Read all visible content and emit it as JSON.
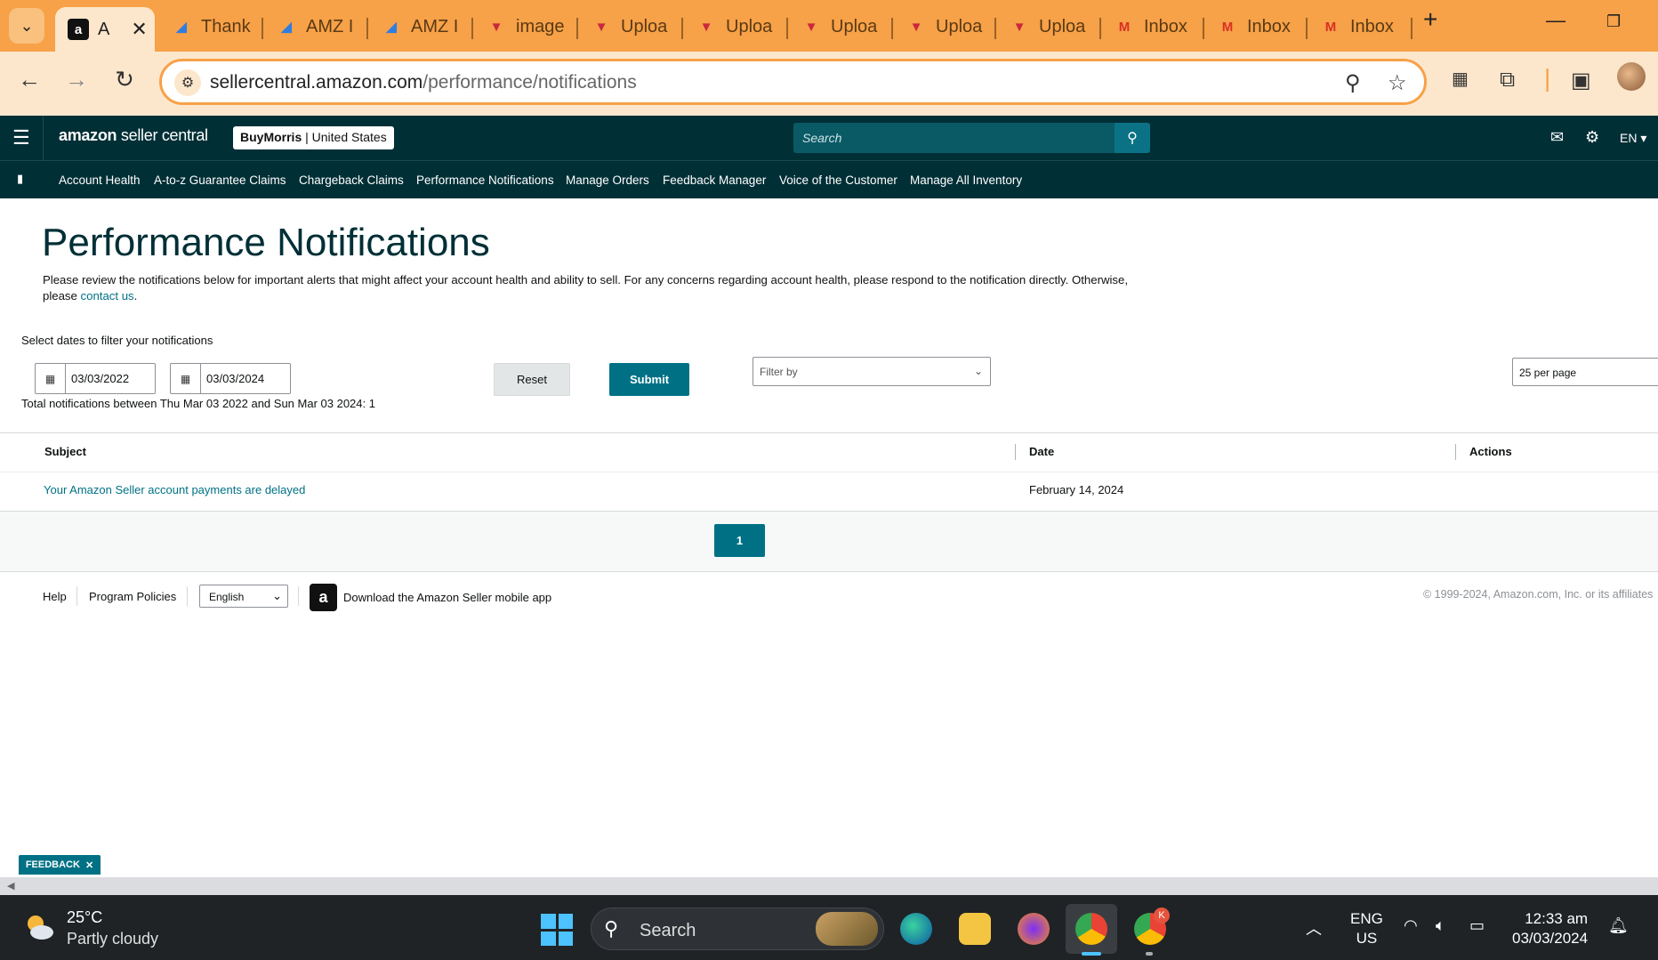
{
  "browser": {
    "tabs": [
      {
        "label": "A",
        "icon": "amazon-icon",
        "active": true
      },
      {
        "label": "Thank",
        "icon": "clickup-icon"
      },
      {
        "label": "AMZ I",
        "icon": "clickup-icon"
      },
      {
        "label": "AMZ I",
        "icon": "clickup-icon"
      },
      {
        "label": "image",
        "icon": "upload-icon"
      },
      {
        "label": "Uploa",
        "icon": "upload-icon"
      },
      {
        "label": "Uploa",
        "icon": "upload-icon"
      },
      {
        "label": "Uploa",
        "icon": "upload-icon"
      },
      {
        "label": "Uploa",
        "icon": "upload-icon"
      },
      {
        "label": "Uploa",
        "icon": "upload-icon"
      },
      {
        "label": "Inbox",
        "icon": "gmail-icon"
      },
      {
        "label": "Inbox",
        "icon": "gmail-icon"
      },
      {
        "label": "Inbox",
        "icon": "gmail-icon"
      }
    ],
    "url_host": "sellercentral.amazon.com",
    "url_path": "/performance/notifications",
    "accent_color": "#f7a148"
  },
  "header": {
    "logo_bold": "amazon",
    "logo_rest": " seller central",
    "store_name": "BuyMorris",
    "store_region": "United States",
    "search_placeholder": "Search",
    "language": "EN"
  },
  "nav": {
    "items": [
      "Account Health",
      "A-to-z Guarantee Claims",
      "Chargeback Claims",
      "Performance Notifications",
      "Manage Orders",
      "Feedback Manager",
      "Voice of the Customer",
      "Manage All Inventory"
    ]
  },
  "main": {
    "title": "Performance Notifications",
    "intro": "Please review the notifications below for important alerts that might affect your account health and ability to sell. For any concerns regarding account health, please respond to the notification directly. Otherwise, please ",
    "intro_link": "contact us",
    "intro_end": ".",
    "filter_label": "Select dates to filter your notifications",
    "date_from": "03/03/2022",
    "date_to": "03/03/2024",
    "reset_label": "Reset",
    "submit_label": "Submit",
    "filter_placeholder": "Filter by",
    "per_page": "25 per page",
    "total_text": "Total notifications between Thu Mar 03 2022 and Sun Mar 03 2024: 1"
  },
  "table": {
    "headers": [
      "Subject",
      "Date",
      "Actions"
    ],
    "rows": [
      {
        "subject": "Your Amazon Seller account payments are delayed",
        "date": "February 14, 2024",
        "actions": ""
      }
    ],
    "current_page": "1"
  },
  "footer": {
    "help": "Help",
    "policies": "Program Policies",
    "language": "English",
    "app_text": "Download the Amazon Seller mobile app",
    "copyright": "© 1999-2024, Amazon.com, Inc. or its affiliates"
  },
  "feedback_label": "FEEDBACK",
  "taskbar": {
    "temperature": "25°C",
    "weather": "Partly cloudy",
    "search_label": "Search",
    "lang_line1": "ENG",
    "lang_line2": "US",
    "time": "12:33 am",
    "date": "03/03/2024",
    "chrome_badge": "K"
  }
}
